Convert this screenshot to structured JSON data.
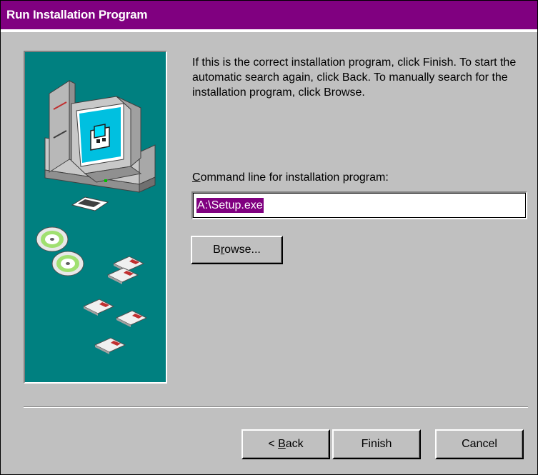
{
  "window": {
    "title": "Run Installation Program"
  },
  "instructions": "If this is the correct installation program, click Finish. To start the automatic search again, click Back. To manually search for the installation program, click Browse.",
  "command_line": {
    "label_accel": "C",
    "label_rest": "ommand line for installation program:",
    "value": "A:\\Setup.exe"
  },
  "buttons": {
    "browse": {
      "accel": "r",
      "prefix": "B",
      "rest": "owse..."
    },
    "back": {
      "prefix": "< ",
      "accel": "B",
      "rest": "ack"
    },
    "finish": "Finish",
    "cancel": "Cancel"
  },
  "colors": {
    "title_bar": "#800080",
    "illustration_bg": "#008080",
    "dialog_bg": "#c0c0c0",
    "selection": "#800080"
  },
  "icons": [
    "computer-icon",
    "cd-disc-icon",
    "floppy-disk-icon"
  ]
}
